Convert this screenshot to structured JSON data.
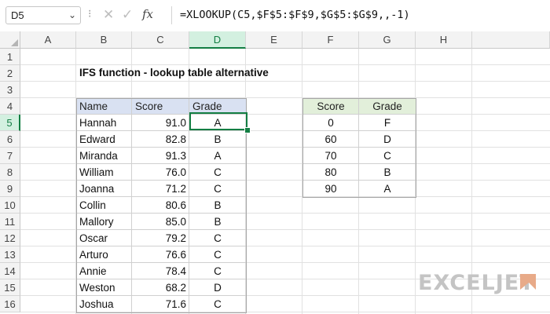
{
  "formula_bar": {
    "name_box": "D5",
    "name_box_arrow": "⌄",
    "dots": "⁝",
    "cancel": "✕",
    "enter": "✓",
    "fx": "fx",
    "formula": "=XLOOKUP(C5,$F$5:$F$9,$G$5:$G$9,,-1)"
  },
  "columns": [
    "A",
    "B",
    "C",
    "D",
    "E",
    "F",
    "G",
    "H"
  ],
  "rows": [
    "1",
    "2",
    "3",
    "4",
    "5",
    "6",
    "7",
    "8",
    "9",
    "10",
    "11",
    "12",
    "13",
    "14",
    "15",
    "16"
  ],
  "title": "IFS function - lookup table alternative",
  "main_table": {
    "headers": [
      "Name",
      "Score",
      "Grade"
    ],
    "rows": [
      {
        "name": "Hannah",
        "score": "91.0",
        "grade": "A"
      },
      {
        "name": "Edward",
        "score": "82.8",
        "grade": "B"
      },
      {
        "name": "Miranda",
        "score": "91.3",
        "grade": "A"
      },
      {
        "name": "William",
        "score": "76.0",
        "grade": "C"
      },
      {
        "name": "Joanna",
        "score": "71.2",
        "grade": "C"
      },
      {
        "name": "Collin",
        "score": "80.6",
        "grade": "B"
      },
      {
        "name": "Mallory",
        "score": "85.0",
        "grade": "B"
      },
      {
        "name": "Oscar",
        "score": "79.2",
        "grade": "C"
      },
      {
        "name": "Arturo",
        "score": "76.6",
        "grade": "C"
      },
      {
        "name": "Annie",
        "score": "78.4",
        "grade": "C"
      },
      {
        "name": "Weston",
        "score": "68.2",
        "grade": "D"
      },
      {
        "name": "Joshua",
        "score": "71.6",
        "grade": "C"
      }
    ]
  },
  "lookup_table": {
    "headers": [
      "Score",
      "Grade"
    ],
    "rows": [
      {
        "score": "0",
        "grade": "F"
      },
      {
        "score": "60",
        "grade": "D"
      },
      {
        "score": "70",
        "grade": "C"
      },
      {
        "score": "80",
        "grade": "B"
      },
      {
        "score": "90",
        "grade": "A"
      }
    ]
  },
  "logo": "EXCELJET",
  "colors": {
    "accent": "#137e43",
    "main_header": "#d9e1f2",
    "lookup_header": "#e2efda"
  }
}
